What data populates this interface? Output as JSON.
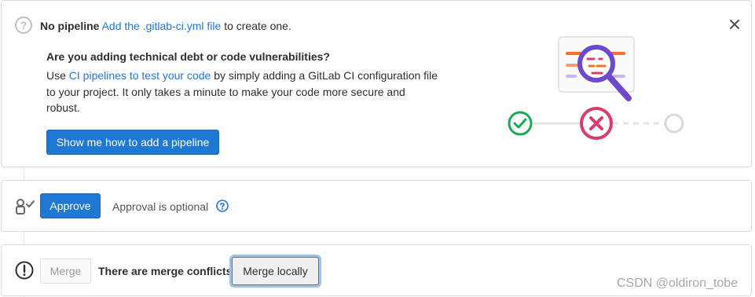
{
  "pipeline_notice": {
    "title": "No pipeline",
    "link": "Add the .gitlab-ci.yml file",
    "suffix": "to create one.",
    "question_icon": "question-circle-icon",
    "close_icon": "close-icon"
  },
  "debt_prompt": {
    "heading": "Are you adding technical debt or code vulnerabilities?",
    "text_prefix": "Use",
    "link": "CI pipelines to test your code",
    "text_suffix": "by simply adding a GitLab CI configuration file to your project. It only takes a minute to make your code more secure and robust.",
    "button": "Show me how to add a pipeline"
  },
  "illustration": {
    "icons": [
      "magnifier-icon",
      "success-icon",
      "failed-icon",
      "pending-icon"
    ],
    "colors": {
      "success": "#1aaa55",
      "failed": "#db3b68",
      "magnifier": "#6e49cb",
      "orange": "#fc6d26"
    }
  },
  "approval": {
    "icon": "approval-icon",
    "button": "Approve",
    "status": "Approval is optional",
    "help_icon": "question-mark-circle-icon"
  },
  "merge": {
    "icon": "warning-circle-icon",
    "button": "Merge",
    "status": "There are merge conflicts",
    "local_button": "Merge locally"
  },
  "watermark": "CSDN @oldiron_tobe",
  "colors": {
    "link": "#1f78d1",
    "primary": "#1f78d1",
    "border": "#dbdbdb"
  }
}
